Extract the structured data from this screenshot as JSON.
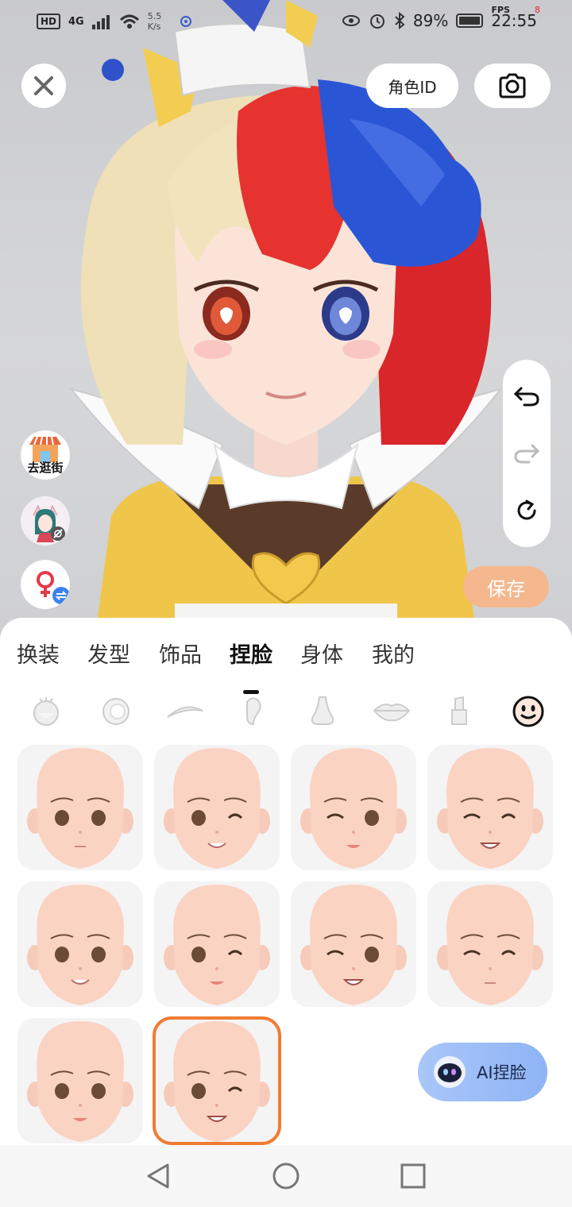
{
  "status_bar": {
    "hd": "HD",
    "network": "4G",
    "speed": "5.5\nK/s",
    "battery": "89%",
    "fps_label": "FPS",
    "fps_value": "8",
    "time": "22:55"
  },
  "header": {
    "close_icon": "close-icon",
    "role_id_label": "角色ID",
    "camera_icon": "camera-icon"
  },
  "tool_rail": {
    "undo_icon": "undo-icon",
    "redo_icon": "redo-icon",
    "reset_icon": "reset-icon"
  },
  "save_label": "保存",
  "left_buttons": {
    "shop_label": "去逛街",
    "profile_icon": "avatar-thumbnail",
    "gender_icon": "female-icon"
  },
  "tabs": [
    {
      "label": "换装",
      "active": false
    },
    {
      "label": "发型",
      "active": false
    },
    {
      "label": "饰品",
      "active": false
    },
    {
      "label": "捏脸",
      "active": true
    },
    {
      "label": "身体",
      "active": false
    },
    {
      "label": "我的",
      "active": false
    }
  ],
  "face_parts": [
    "face-shape-icon",
    "eye-icon",
    "eyebrow-icon",
    "ear-icon",
    "nose-icon",
    "lips-icon",
    "lipstick-icon",
    "expression-icon"
  ],
  "face_presets": [
    {
      "id": 1,
      "selected": false
    },
    {
      "id": 2,
      "selected": false
    },
    {
      "id": 3,
      "selected": false
    },
    {
      "id": 4,
      "selected": false
    },
    {
      "id": 5,
      "selected": false
    },
    {
      "id": 6,
      "selected": false
    },
    {
      "id": 7,
      "selected": false
    },
    {
      "id": 8,
      "selected": false
    },
    {
      "id": 9,
      "selected": false
    },
    {
      "id": 10,
      "selected": true
    }
  ],
  "ai_button_label": "AI捏脸",
  "colors": {
    "accent_orange": "#f07c33",
    "save_button": "#f5b78e",
    "ai_button": "#9dbdf7"
  }
}
